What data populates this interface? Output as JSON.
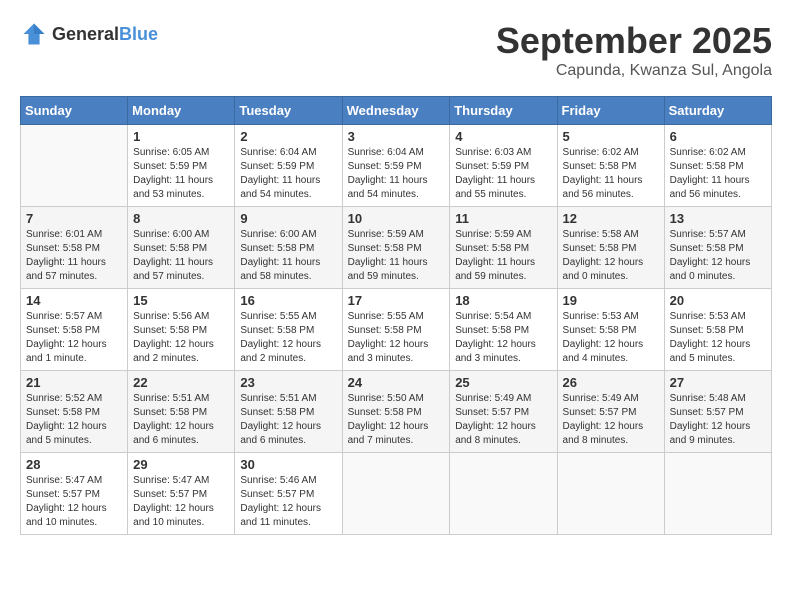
{
  "header": {
    "logo_general": "General",
    "logo_blue": "Blue",
    "month": "September 2025",
    "location": "Capunda, Kwanza Sul, Angola"
  },
  "days_of_week": [
    "Sunday",
    "Monday",
    "Tuesday",
    "Wednesday",
    "Thursday",
    "Friday",
    "Saturday"
  ],
  "weeks": [
    [
      null,
      {
        "day": 1,
        "sunrise": "6:05 AM",
        "sunset": "5:59 PM",
        "daylight": "11 hours and 53 minutes."
      },
      {
        "day": 2,
        "sunrise": "6:04 AM",
        "sunset": "5:59 PM",
        "daylight": "11 hours and 54 minutes."
      },
      {
        "day": 3,
        "sunrise": "6:04 AM",
        "sunset": "5:59 PM",
        "daylight": "11 hours and 54 minutes."
      },
      {
        "day": 4,
        "sunrise": "6:03 AM",
        "sunset": "5:59 PM",
        "daylight": "11 hours and 55 minutes."
      },
      {
        "day": 5,
        "sunrise": "6:02 AM",
        "sunset": "5:58 PM",
        "daylight": "11 hours and 56 minutes."
      },
      {
        "day": 6,
        "sunrise": "6:02 AM",
        "sunset": "5:58 PM",
        "daylight": "11 hours and 56 minutes."
      }
    ],
    [
      {
        "day": 7,
        "sunrise": "6:01 AM",
        "sunset": "5:58 PM",
        "daylight": "11 hours and 57 minutes."
      },
      {
        "day": 8,
        "sunrise": "6:00 AM",
        "sunset": "5:58 PM",
        "daylight": "11 hours and 57 minutes."
      },
      {
        "day": 9,
        "sunrise": "6:00 AM",
        "sunset": "5:58 PM",
        "daylight": "11 hours and 58 minutes."
      },
      {
        "day": 10,
        "sunrise": "5:59 AM",
        "sunset": "5:58 PM",
        "daylight": "11 hours and 59 minutes."
      },
      {
        "day": 11,
        "sunrise": "5:59 AM",
        "sunset": "5:58 PM",
        "daylight": "11 hours and 59 minutes."
      },
      {
        "day": 12,
        "sunrise": "5:58 AM",
        "sunset": "5:58 PM",
        "daylight": "12 hours and 0 minutes."
      },
      {
        "day": 13,
        "sunrise": "5:57 AM",
        "sunset": "5:58 PM",
        "daylight": "12 hours and 0 minutes."
      }
    ],
    [
      {
        "day": 14,
        "sunrise": "5:57 AM",
        "sunset": "5:58 PM",
        "daylight": "12 hours and 1 minute."
      },
      {
        "day": 15,
        "sunrise": "5:56 AM",
        "sunset": "5:58 PM",
        "daylight": "12 hours and 2 minutes."
      },
      {
        "day": 16,
        "sunrise": "5:55 AM",
        "sunset": "5:58 PM",
        "daylight": "12 hours and 2 minutes."
      },
      {
        "day": 17,
        "sunrise": "5:55 AM",
        "sunset": "5:58 PM",
        "daylight": "12 hours and 3 minutes."
      },
      {
        "day": 18,
        "sunrise": "5:54 AM",
        "sunset": "5:58 PM",
        "daylight": "12 hours and 3 minutes."
      },
      {
        "day": 19,
        "sunrise": "5:53 AM",
        "sunset": "5:58 PM",
        "daylight": "12 hours and 4 minutes."
      },
      {
        "day": 20,
        "sunrise": "5:53 AM",
        "sunset": "5:58 PM",
        "daylight": "12 hours and 5 minutes."
      }
    ],
    [
      {
        "day": 21,
        "sunrise": "5:52 AM",
        "sunset": "5:58 PM",
        "daylight": "12 hours and 5 minutes."
      },
      {
        "day": 22,
        "sunrise": "5:51 AM",
        "sunset": "5:58 PM",
        "daylight": "12 hours and 6 minutes."
      },
      {
        "day": 23,
        "sunrise": "5:51 AM",
        "sunset": "5:58 PM",
        "daylight": "12 hours and 6 minutes."
      },
      {
        "day": 24,
        "sunrise": "5:50 AM",
        "sunset": "5:58 PM",
        "daylight": "12 hours and 7 minutes."
      },
      {
        "day": 25,
        "sunrise": "5:49 AM",
        "sunset": "5:57 PM",
        "daylight": "12 hours and 8 minutes."
      },
      {
        "day": 26,
        "sunrise": "5:49 AM",
        "sunset": "5:57 PM",
        "daylight": "12 hours and 8 minutes."
      },
      {
        "day": 27,
        "sunrise": "5:48 AM",
        "sunset": "5:57 PM",
        "daylight": "12 hours and 9 minutes."
      }
    ],
    [
      {
        "day": 28,
        "sunrise": "5:47 AM",
        "sunset": "5:57 PM",
        "daylight": "12 hours and 10 minutes."
      },
      {
        "day": 29,
        "sunrise": "5:47 AM",
        "sunset": "5:57 PM",
        "daylight": "12 hours and 10 minutes."
      },
      {
        "day": 30,
        "sunrise": "5:46 AM",
        "sunset": "5:57 PM",
        "daylight": "12 hours and 11 minutes."
      },
      null,
      null,
      null,
      null
    ]
  ]
}
